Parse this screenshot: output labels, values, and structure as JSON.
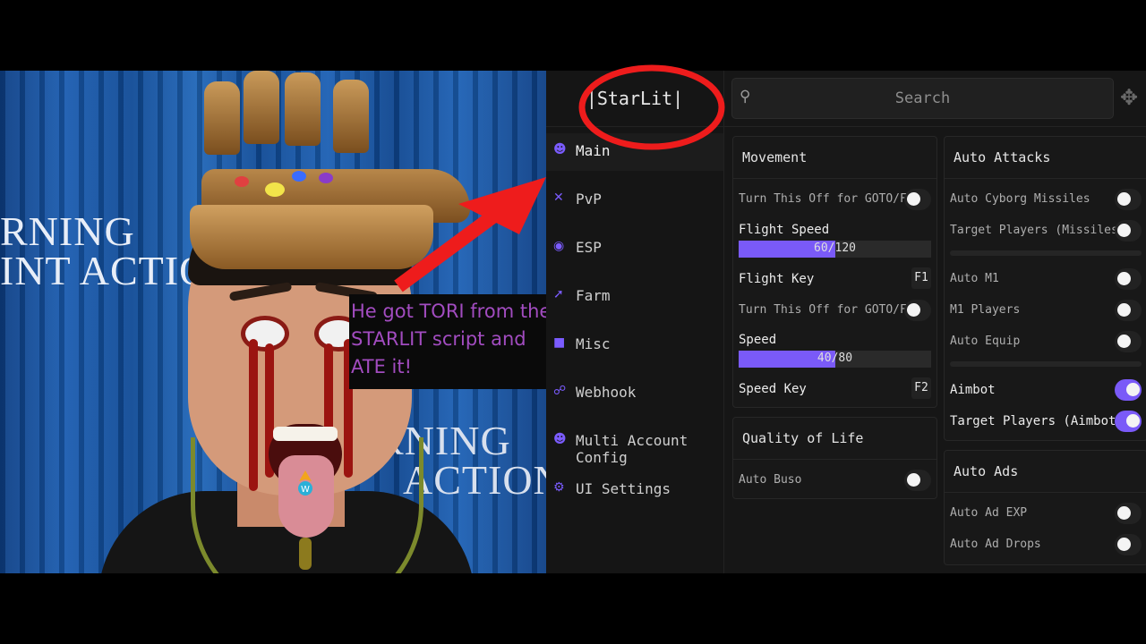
{
  "caption": {
    "line1": "He got TORI from the",
    "line2": "STARLIT script and",
    "line3": "ATE it!"
  },
  "backdrop": {
    "line1": "RNING",
    "line2": "INT ACTION",
    "line3": "RNING",
    "line4": "ACTION"
  },
  "app": {
    "title": "|StarLit|"
  },
  "search": {
    "placeholder": "Search"
  },
  "sidebar": {
    "items": [
      {
        "label": "Main",
        "icon": "person-icon"
      },
      {
        "label": "PvP",
        "icon": "swords-icon"
      },
      {
        "label": "ESP",
        "icon": "eye-icon"
      },
      {
        "label": "Farm",
        "icon": "sword-icon"
      },
      {
        "label": "Misc",
        "icon": "misc-icon"
      },
      {
        "label": "Webhook",
        "icon": "webhook-icon"
      },
      {
        "label": "Multi Account Config",
        "icon": "people-icon"
      },
      {
        "label": "UI Settings",
        "icon": "gear-icon"
      }
    ]
  },
  "movement": {
    "title": "Movement",
    "toggle1": "Turn This Off for GOTO/FARM",
    "flight_speed_label": "Flight Speed",
    "flight_speed_value": "60/120",
    "flight_speed_fraction": 0.5,
    "flight_key_label": "Flight Key",
    "flight_key": "F1",
    "toggle2": "Turn This Off for GOTO/FARM",
    "speed_label": "Speed",
    "speed_value": "40/80",
    "speed_fraction": 0.5,
    "speed_key_label": "Speed Key",
    "speed_key": "F2"
  },
  "quality": {
    "title": "Quality of Life",
    "auto_buso": "Auto Buso"
  },
  "auto_attacks": {
    "title": "Auto Attacks",
    "auto_cyborg": "Auto Cyborg Missiles",
    "target_missiles": "Target Players (Missiles)",
    "auto_m1": "Auto M1",
    "m1_players": "M1 Players",
    "auto_equip": "Auto Equip",
    "aimbot": "Aimbot",
    "target_aimbot": "Target Players (Aimbot)"
  },
  "auto_ads": {
    "title": "Auto Ads",
    "exp": "Auto Ad EXP",
    "drops": "Auto Ad Drops"
  },
  "colors": {
    "accent": "#7a5af8",
    "caption_text": "#a24cc0",
    "arrow": "#ee1c1c"
  }
}
